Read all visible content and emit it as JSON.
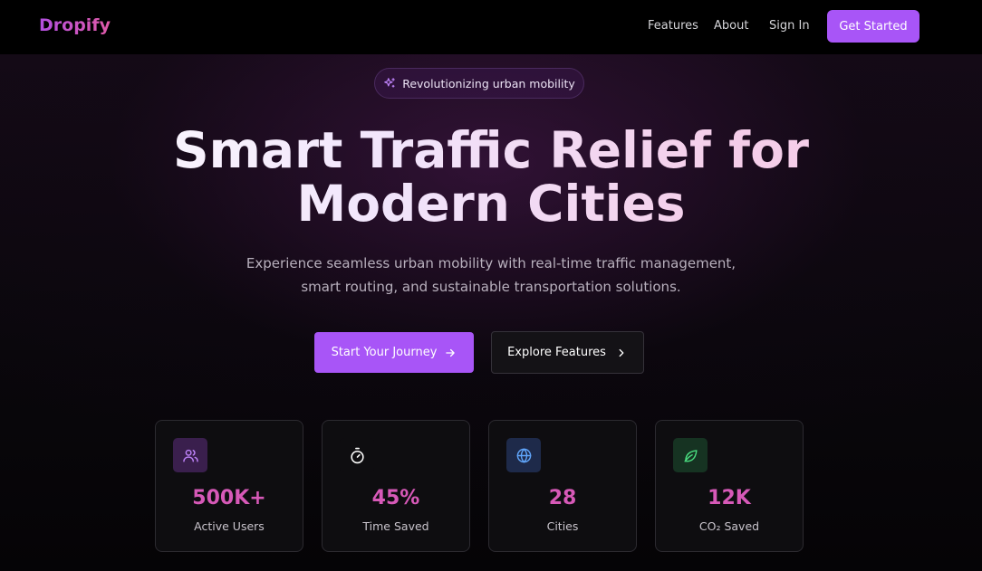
{
  "nav": {
    "logo": "Dropify",
    "links": [
      "Features",
      "About",
      "Sign In"
    ],
    "cta": "Get Started"
  },
  "hero": {
    "badge": "Revolutionizing urban mobility",
    "title_line1": "Smart Traffic Relief for",
    "title_line2": "Modern Cities",
    "subtitle_line1": "Experience seamless urban mobility with real-time traffic management,",
    "subtitle_line2": "smart routing, and sustainable transportation solutions.",
    "primary_button": "Start Your Journey",
    "secondary_button": "Explore Features"
  },
  "stats": [
    {
      "icon": "users-icon",
      "value": "500K+",
      "label": "Active Users",
      "icon_bg": "#3a1f4d",
      "icon_color": "#c084fc"
    },
    {
      "icon": "timer-icon",
      "value": "45%",
      "label": "Time Saved",
      "icon_bg": "#0e0d10",
      "icon_color": "#ffffff"
    },
    {
      "icon": "globe-icon",
      "value": "28",
      "label": "Cities",
      "icon_bg": "#1e2a4a",
      "icon_color": "#60a5fa"
    },
    {
      "icon": "leaf-icon",
      "value": "12K",
      "label": "CO₂ Saved",
      "icon_bg": "#163322",
      "icon_color": "#4ade80"
    }
  ],
  "colors": {
    "accent": "#a855f7",
    "stat_value": "#d759b8"
  }
}
